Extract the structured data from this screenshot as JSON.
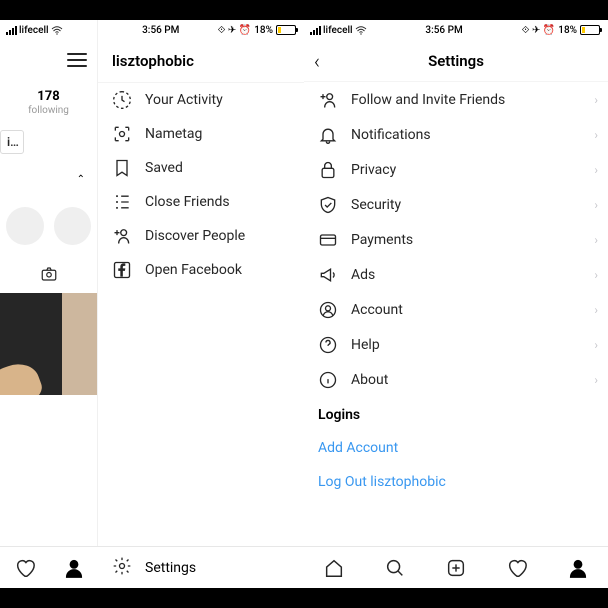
{
  "statusbar": {
    "carrier": "lifecell",
    "time": "3:56 PM",
    "battery_pct": "18%"
  },
  "left": {
    "username": "lisztophobic",
    "stat_count": "178",
    "stat_label": "following",
    "edit_label": "ile",
    "menu": {
      "activity": "Your Activity",
      "nametag": "Nametag",
      "saved": "Saved",
      "close_friends": "Close Friends",
      "discover": "Discover People",
      "facebook": "Open Facebook"
    },
    "settings_label": "Settings"
  },
  "right": {
    "title": "Settings",
    "items": {
      "follow_invite": "Follow and Invite Friends",
      "notifications": "Notifications",
      "privacy": "Privacy",
      "security": "Security",
      "payments": "Payments",
      "ads": "Ads",
      "account": "Account",
      "help": "Help",
      "about": "About"
    },
    "logins_header": "Logins",
    "add_account": "Add Account",
    "logout": "Log Out lisztophobic"
  }
}
